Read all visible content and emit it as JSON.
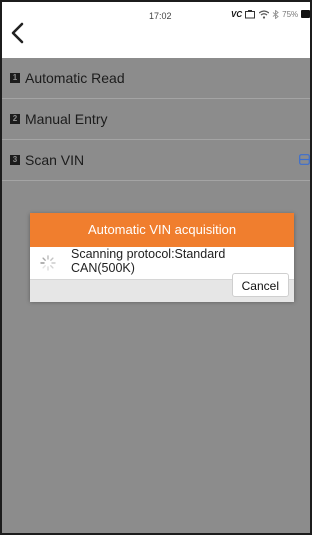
{
  "status_bar": {
    "time": "17:02",
    "vci_label": "VC",
    "battery_text": "75%"
  },
  "header": {
    "back_icon": "chevron-left-icon"
  },
  "menu": {
    "items": [
      {
        "number": "1",
        "label": "Automatic Read"
      },
      {
        "number": "2",
        "label": "Manual Entry"
      },
      {
        "number": "3",
        "label": "Scan VIN",
        "icon": "scan-icon"
      }
    ]
  },
  "dialog": {
    "title": "Automatic VIN acquisition",
    "message": "Scanning protocol:Standard CAN(500K)",
    "cancel_label": "Cancel"
  },
  "colors": {
    "accent": "#f07e2e",
    "overlay": "#8c8c8c",
    "scan_icon": "#3c6fd0"
  }
}
